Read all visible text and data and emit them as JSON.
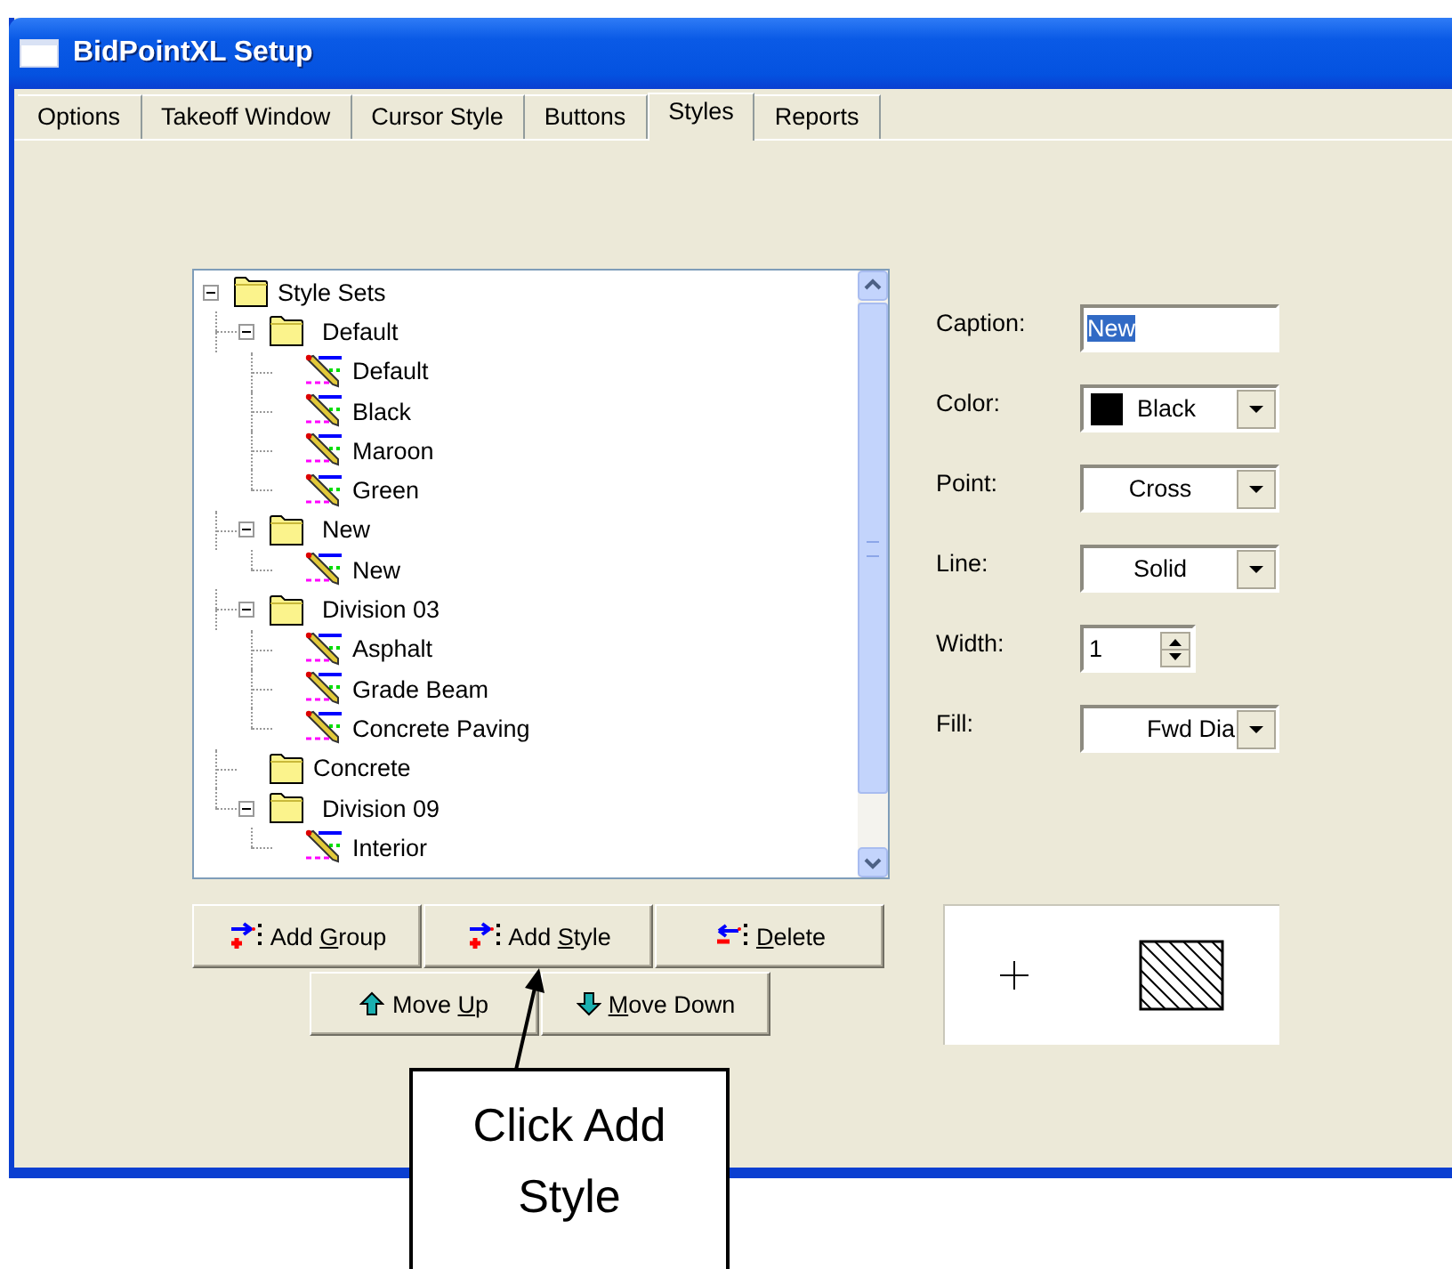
{
  "window": {
    "title": "BidPointXL Setup"
  },
  "tabs": [
    {
      "label": "Options",
      "selected": false
    },
    {
      "label": "Takeoff Window",
      "selected": false
    },
    {
      "label": "Cursor Style",
      "selected": false
    },
    {
      "label": "Buttons",
      "selected": false
    },
    {
      "label": "Styles",
      "selected": true
    },
    {
      "label": "Reports",
      "selected": false
    }
  ],
  "tree": [
    {
      "label": "Style Sets",
      "kind": "group",
      "expanded": true,
      "children": [
        {
          "label": "Default",
          "kind": "group",
          "expanded": true,
          "children": [
            {
              "label": "Default",
              "kind": "style"
            },
            {
              "label": "Black",
              "kind": "style"
            },
            {
              "label": "Maroon",
              "kind": "style"
            },
            {
              "label": "Green",
              "kind": "style"
            }
          ]
        },
        {
          "label": "New",
          "kind": "group",
          "expanded": true,
          "children": [
            {
              "label": "New",
              "kind": "style"
            }
          ]
        },
        {
          "label": "Division 03",
          "kind": "group",
          "expanded": true,
          "children": [
            {
              "label": "Asphalt",
              "kind": "style"
            },
            {
              "label": "Grade Beam",
              "kind": "style"
            },
            {
              "label": "Concrete Paving",
              "kind": "style"
            }
          ]
        },
        {
          "label": "Concrete",
          "kind": "group"
        },
        {
          "label": "Division 09",
          "kind": "group",
          "expanded": true,
          "children": [
            {
              "label": "Interior",
              "kind": "style"
            }
          ]
        }
      ]
    }
  ],
  "buttons": [
    {
      "before": "Add ",
      "key": "G",
      "after": "roup",
      "kind": "add-group"
    },
    {
      "before": "Add ",
      "key": "S",
      "after": "tyle",
      "kind": "add-style"
    },
    {
      "key": "D",
      "after": "elete",
      "kind": "delete"
    }
  ],
  "move_buttons": [
    {
      "before": "Move ",
      "key": "U",
      "after": "p",
      "kind": "up"
    },
    {
      "key": "M",
      "after": "ove Down",
      "kind": "down"
    }
  ],
  "fields": [
    {
      "label": "Caption:",
      "kind": "text",
      "value": "New",
      "text_selected": true
    },
    {
      "label": "Color:",
      "kind": "color",
      "value": "Black",
      "color": "#000000"
    },
    {
      "label": "Point:",
      "kind": "combo",
      "value": "Cross"
    },
    {
      "label": "Line:",
      "kind": "combo",
      "value": "Solid"
    },
    {
      "label": "Width:",
      "kind": "spin",
      "value": "1"
    },
    {
      "label": "Fill:",
      "kind": "combo-right",
      "value": "Fwd Dia"
    }
  ],
  "callout": {
    "text": "Click Add Style"
  }
}
